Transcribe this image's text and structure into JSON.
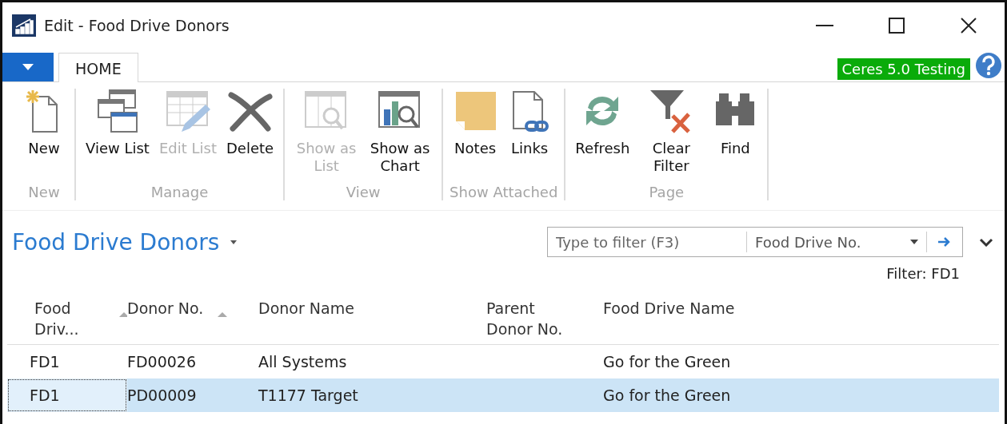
{
  "window": {
    "title": "Edit - Food Drive Donors"
  },
  "tabs": [
    {
      "label": "HOME",
      "selected": true
    }
  ],
  "company_badge": "Ceres 5.0 Testing",
  "ribbon": {
    "groups": [
      {
        "label": "New",
        "buttons": [
          {
            "label": "New",
            "disabled": false
          }
        ]
      },
      {
        "label": "Manage",
        "buttons": [
          {
            "label": "View List",
            "disabled": false
          },
          {
            "label": "Edit List",
            "disabled": true
          },
          {
            "label": "Delete",
            "disabled": false
          }
        ]
      },
      {
        "label": "View",
        "buttons": [
          {
            "label": "Show as List",
            "disabled": true
          },
          {
            "label": "Show as Chart",
            "disabled": false
          }
        ]
      },
      {
        "label": "Show Attached",
        "buttons": [
          {
            "label": "Notes",
            "disabled": false
          },
          {
            "label": "Links",
            "disabled": false
          }
        ]
      },
      {
        "label": "Page",
        "buttons": [
          {
            "label": "Refresh",
            "disabled": false
          },
          {
            "label": "Clear Filter",
            "disabled": false
          },
          {
            "label": "Find",
            "disabled": false
          }
        ]
      }
    ]
  },
  "page_title": "Food Drive Donors",
  "filter_box": {
    "placeholder": "Type to filter (F3)",
    "field": "Food Drive No."
  },
  "filter_label": "Filter: FD1",
  "table": {
    "columns": [
      {
        "label": "Food Driv...",
        "sorted": true
      },
      {
        "label": "Donor No.",
        "sorted": true
      },
      {
        "label": "Donor Name",
        "sorted": false
      },
      {
        "label": "Parent Donor No.",
        "sorted": false
      },
      {
        "label": "Food Drive Name",
        "sorted": false
      }
    ],
    "rows": [
      {
        "cells": [
          "FD1",
          "FD00026",
          "All Systems",
          "",
          "Go for the Green"
        ],
        "selected": false
      },
      {
        "cells": [
          "FD1",
          "PD00009",
          "T1177 Target",
          "",
          "Go for the Green"
        ],
        "selected": true
      }
    ]
  }
}
